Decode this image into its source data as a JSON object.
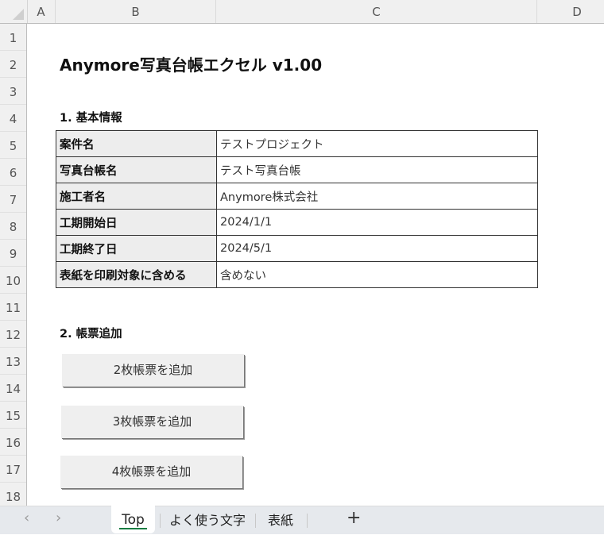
{
  "columns": [
    "A",
    "B",
    "C",
    "D"
  ],
  "rows": [
    "1",
    "2",
    "3",
    "4",
    "5",
    "6",
    "7",
    "8",
    "9",
    "10",
    "11",
    "12",
    "13",
    "14",
    "15",
    "16",
    "17",
    "18"
  ],
  "title": "Anymore写真台帳エクセル v1.00",
  "section1": "1. 基本情報",
  "info": [
    {
      "label": "案件名",
      "value": "テストプロジェクト"
    },
    {
      "label": "写真台帳名",
      "value": "テスト写真台帳"
    },
    {
      "label": "施工者名",
      "value": "Anymore株式会社"
    },
    {
      "label": "工期開始日",
      "value": "2024/1/1"
    },
    {
      "label": "工期終了日",
      "value": "2024/5/1"
    },
    {
      "label": "表紙を印刷対象に含める",
      "value": "含めない"
    }
  ],
  "section2": "2. 帳票追加",
  "buttons": [
    "2枚帳票を追加",
    "3枚帳票を追加",
    "4枚帳票を追加"
  ],
  "sheet_tabs": {
    "prev": "‹",
    "next": "›",
    "tabs": [
      "Top",
      "よく使う文字",
      "表紙"
    ],
    "active": "Top",
    "add": "+"
  }
}
